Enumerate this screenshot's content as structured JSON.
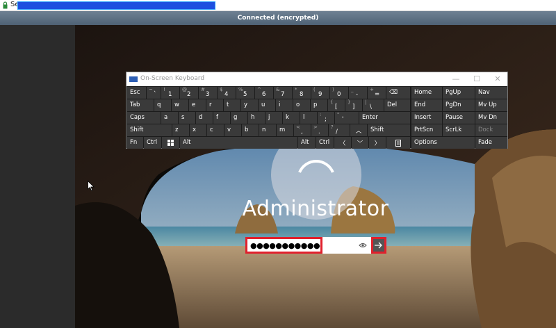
{
  "browser": {
    "site_text": "Se",
    "url_redacted": true
  },
  "session": {
    "status": "Connected (encrypted)"
  },
  "login": {
    "username": "Administrator",
    "password_value": "●●●●●●●●●●●●●●●●●",
    "submit_icon": "arrow-right-icon",
    "reveal_icon": "eye-icon"
  },
  "keyboard": {
    "title": "On-Screen Keyboard",
    "controls": {
      "minimize": "—",
      "maximize": "☐",
      "close": "✕"
    },
    "row1": {
      "esc": "Esc",
      "keys": [
        {
          "main": "`",
          "shift": "~"
        },
        {
          "main": "1",
          "shift": "!"
        },
        {
          "main": "2",
          "shift": "@"
        },
        {
          "main": "3",
          "shift": "#"
        },
        {
          "main": "4",
          "shift": "$"
        },
        {
          "main": "5",
          "shift": "%"
        },
        {
          "main": "6",
          "shift": "^"
        },
        {
          "main": "7",
          "shift": "&"
        },
        {
          "main": "8",
          "shift": "*"
        },
        {
          "main": "9",
          "shift": "("
        },
        {
          "main": "0",
          "shift": ")"
        },
        {
          "main": "-",
          "shift": "_"
        },
        {
          "main": "=",
          "shift": "+"
        }
      ],
      "backspace": "⌫"
    },
    "row2": {
      "tab": "Tab",
      "keys": [
        "q",
        "w",
        "e",
        "r",
        "t",
        "y",
        "u",
        "i",
        "o",
        "p"
      ],
      "brackets": [
        {
          "main": "[",
          "shift": "{"
        },
        {
          "main": "]",
          "shift": "}"
        },
        {
          "main": "\\",
          "shift": "|"
        }
      ],
      "del": "Del"
    },
    "row3": {
      "caps": "Caps",
      "keys": [
        "a",
        "s",
        "d",
        "f",
        "g",
        "h",
        "j",
        "k",
        "l"
      ],
      "punct": [
        {
          "main": ";",
          "shift": ":"
        },
        {
          "main": "'",
          "shift": "\""
        }
      ],
      "enter": "Enter"
    },
    "row4": {
      "shift_left": "Shift",
      "keys": [
        "z",
        "x",
        "c",
        "v",
        "b",
        "n",
        "m"
      ],
      "punct": [
        {
          "main": ",",
          "shift": "<"
        },
        {
          "main": ".",
          "shift": ">"
        },
        {
          "main": "/",
          "shift": "?"
        }
      ],
      "up": "︿",
      "shift_right": "Shift"
    },
    "row5": {
      "fn": "Fn",
      "ctrl_left": "Ctrl",
      "win_icon": "windows-icon",
      "alt_left": "Alt",
      "alt_right": "Alt",
      "ctrl_right": "Ctrl",
      "left": "〈",
      "down": "﹀",
      "right": "〉",
      "menu_icon": "menu-key-icon"
    },
    "nav": {
      "home": "Home",
      "pgup": "PgUp",
      "nav": "Nav",
      "end": "End",
      "pgdn": "PgDn",
      "mvup": "Mv Up",
      "insert": "Insert",
      "pause": "Pause",
      "mvdn": "Mv Dn",
      "prtscn": "PrtScn",
      "scrlk": "ScrLk",
      "dock": "Dock",
      "options": "Options",
      "fade": "Fade"
    }
  },
  "colors": {
    "highlight_red": "#e0202c",
    "status_bar": "#5a6d80",
    "key_bg": "#3a3a3a"
  }
}
